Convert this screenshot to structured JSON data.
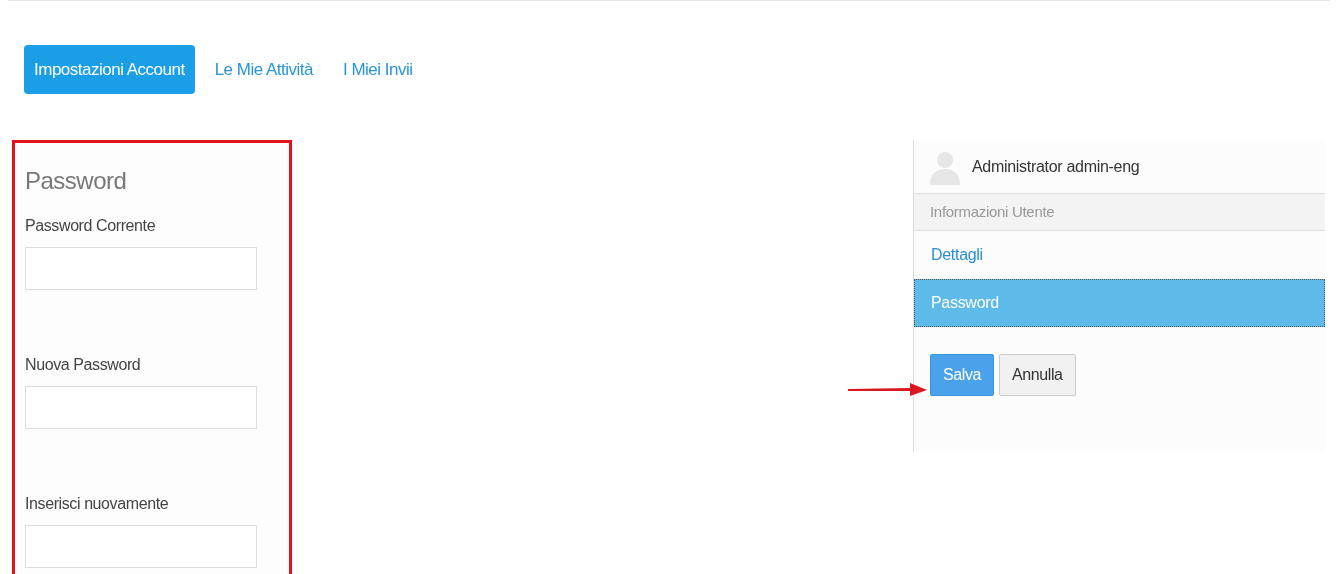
{
  "tabs": [
    {
      "label": "Impostazioni Account",
      "selected": true
    },
    {
      "label": "Le Mie Attività",
      "selected": false
    },
    {
      "label": "I Miei Invii",
      "selected": false
    }
  ],
  "password_form": {
    "title": "Password",
    "fields": [
      {
        "label": "Password Corrente"
      },
      {
        "label": "Nuova Password"
      },
      {
        "label": "Inserisci nuovamente"
      }
    ]
  },
  "user_panel": {
    "name": "Administrator admin-eng",
    "menu": [
      {
        "kind": "header",
        "label": "Informazioni Utente"
      },
      {
        "kind": "link",
        "label": "Dettagli",
        "selected": false
      },
      {
        "kind": "link",
        "label": "Password",
        "selected": true
      }
    ],
    "buttons": [
      {
        "kind": "primary",
        "label": "Salva"
      },
      {
        "kind": "default",
        "label": "Annulla"
      }
    ]
  }
}
